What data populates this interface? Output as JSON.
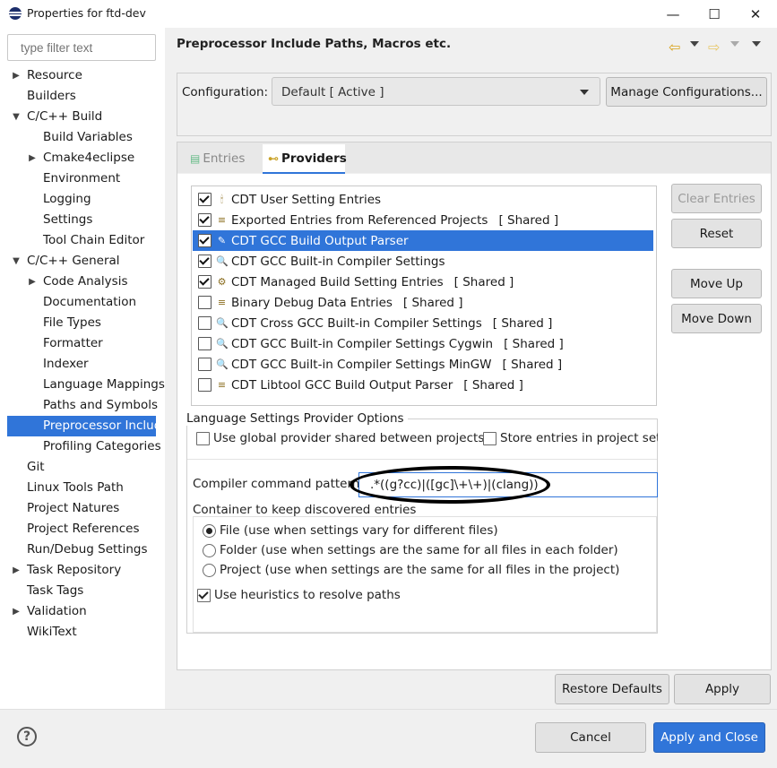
{
  "window": {
    "title": "Properties for ftd-dev",
    "minimize_glyph": "—",
    "maximize_glyph": "☐",
    "close_glyph": "✕"
  },
  "filter": {
    "placeholder": "type filter text"
  },
  "tree": [
    {
      "label": "Resource",
      "level": 0,
      "arrow": "▶"
    },
    {
      "label": "Builders",
      "level": 0,
      "arrow": ""
    },
    {
      "label": "C/C++ Build",
      "level": 0,
      "arrow": "▼"
    },
    {
      "label": "Build Variables",
      "level": 1,
      "arrow": ""
    },
    {
      "label": "Cmake4eclipse",
      "level": 1,
      "arrow": "▶"
    },
    {
      "label": "Environment",
      "level": 1,
      "arrow": ""
    },
    {
      "label": "Logging",
      "level": 1,
      "arrow": ""
    },
    {
      "label": "Settings",
      "level": 1,
      "arrow": ""
    },
    {
      "label": "Tool Chain Editor",
      "level": 1,
      "arrow": ""
    },
    {
      "label": "C/C++ General",
      "level": 0,
      "arrow": "▼"
    },
    {
      "label": "Code Analysis",
      "level": 1,
      "arrow": "▶"
    },
    {
      "label": "Documentation",
      "level": 1,
      "arrow": ""
    },
    {
      "label": "File Types",
      "level": 1,
      "arrow": ""
    },
    {
      "label": "Formatter",
      "level": 1,
      "arrow": ""
    },
    {
      "label": "Indexer",
      "level": 1,
      "arrow": ""
    },
    {
      "label": "Language Mappings",
      "level": 1,
      "arrow": ""
    },
    {
      "label": "Paths and Symbols",
      "level": 1,
      "arrow": ""
    },
    {
      "label": "Preprocessor Includ",
      "level": 1,
      "arrow": "",
      "selected": true
    },
    {
      "label": "Profiling Categories",
      "level": 1,
      "arrow": ""
    },
    {
      "label": "Git",
      "level": 0,
      "arrow": ""
    },
    {
      "label": "Linux Tools Path",
      "level": 0,
      "arrow": ""
    },
    {
      "label": "Project Natures",
      "level": 0,
      "arrow": ""
    },
    {
      "label": "Project References",
      "level": 0,
      "arrow": ""
    },
    {
      "label": "Run/Debug Settings",
      "level": 0,
      "arrow": ""
    },
    {
      "label": "Task Repository",
      "level": 0,
      "arrow": "▶"
    },
    {
      "label": "Task Tags",
      "level": 0,
      "arrow": ""
    },
    {
      "label": "Validation",
      "level": 0,
      "arrow": "▶"
    },
    {
      "label": "WikiText",
      "level": 0,
      "arrow": ""
    }
  ],
  "page": {
    "title": "Preprocessor Include Paths, Macros etc."
  },
  "config": {
    "label": "Configuration:",
    "value": "Default  [ Active ]",
    "manage_button": "Manage Configurations..."
  },
  "tabs": {
    "entries": "Entries",
    "providers": "Providers"
  },
  "providers": [
    {
      "label": "CDT User Setting Entries",
      "shared": "",
      "checked": true,
      "icon": "🕯",
      "icon_name": "user-setting-icon"
    },
    {
      "label": "Exported Entries from Referenced Projects",
      "shared": "[ Shared ]",
      "checked": true,
      "icon": "≡",
      "icon_name": "exported-entries-icon"
    },
    {
      "label": "CDT GCC Build Output Parser",
      "shared": "",
      "checked": true,
      "icon": "✎",
      "icon_name": "build-output-parser-icon",
      "selected": true
    },
    {
      "label": "CDT GCC Built-in Compiler Settings",
      "shared": "",
      "checked": true,
      "icon": "🔍",
      "icon_name": "compiler-settings-icon"
    },
    {
      "label": "CDT Managed Build Setting Entries",
      "shared": "[ Shared ]",
      "checked": true,
      "icon": "⚙",
      "icon_name": "managed-build-icon"
    },
    {
      "label": "Binary Debug Data Entries",
      "shared": "[ Shared ]",
      "checked": false,
      "icon": "≡",
      "icon_name": "binary-debug-icon"
    },
    {
      "label": "CDT Cross GCC Built-in Compiler Settings",
      "shared": "[ Shared ]",
      "checked": false,
      "icon": "🔍",
      "icon_name": "cross-compiler-icon"
    },
    {
      "label": "CDT GCC Built-in Compiler Settings Cygwin",
      "shared": "[ Shared ]",
      "checked": false,
      "icon": "🔍",
      "icon_name": "cygwin-compiler-icon"
    },
    {
      "label": "CDT GCC Built-in Compiler Settings MinGW",
      "shared": "[ Shared ]",
      "checked": false,
      "icon": "🔍",
      "icon_name": "mingw-compiler-icon"
    },
    {
      "label": "CDT Libtool GCC Build Output Parser",
      "shared": "[ Shared ]",
      "checked": false,
      "icon": "≡",
      "icon_name": "libtool-parser-icon"
    }
  ],
  "side_buttons": {
    "clear_entries": "Clear Entries",
    "reset": "Reset",
    "move_up": "Move Up",
    "move_down": "Move Down"
  },
  "options": {
    "group_label": "Language Settings Provider Options",
    "use_global": "Use global provider shared between projects",
    "store_entries": "Store entries in project sett",
    "compiler_pattern_label": "Compiler command pattern",
    "compiler_pattern_value": ".*((g?cc)|([gc]\\+\\+)|(clang))",
    "container_label": "Container to keep discovered entries",
    "radio_file": "File (use when settings vary for different files)",
    "radio_folder": "Folder (use when settings are the same for all files in each folder)",
    "radio_project": "Project (use when settings are the same for all files in the project)",
    "heuristics": "Use heuristics to resolve paths"
  },
  "buttons": {
    "restore_defaults": "Restore Defaults",
    "apply": "Apply",
    "cancel": "Cancel",
    "apply_and_close": "Apply and Close"
  },
  "colors": {
    "selection": "#3075d9",
    "primary_button": "#3075d9"
  }
}
